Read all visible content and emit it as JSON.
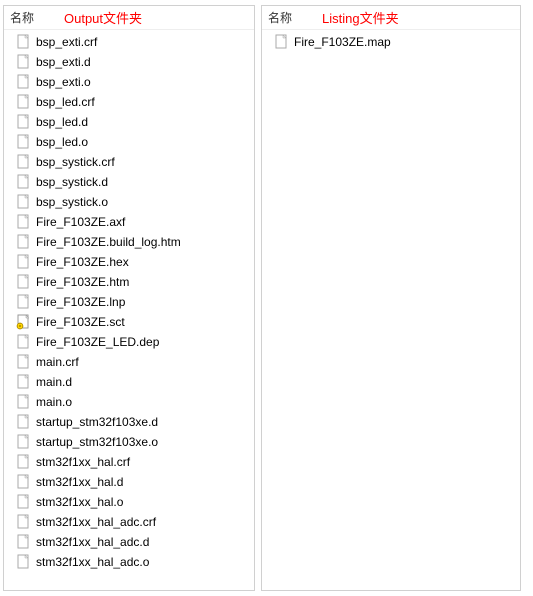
{
  "left": {
    "column_header": "名称",
    "folder_title": "Output文件夹",
    "files": [
      {
        "name": "bsp_exti.crf",
        "icon": "file"
      },
      {
        "name": "bsp_exti.d",
        "icon": "file"
      },
      {
        "name": "bsp_exti.o",
        "icon": "file"
      },
      {
        "name": "bsp_led.crf",
        "icon": "file"
      },
      {
        "name": "bsp_led.d",
        "icon": "file"
      },
      {
        "name": "bsp_led.o",
        "icon": "file"
      },
      {
        "name": "bsp_systick.crf",
        "icon": "file"
      },
      {
        "name": "bsp_systick.d",
        "icon": "file"
      },
      {
        "name": "bsp_systick.o",
        "icon": "file"
      },
      {
        "name": "Fire_F103ZE.axf",
        "icon": "file"
      },
      {
        "name": "Fire_F103ZE.build_log.htm",
        "icon": "file"
      },
      {
        "name": "Fire_F103ZE.hex",
        "icon": "file"
      },
      {
        "name": "Fire_F103ZE.htm",
        "icon": "file"
      },
      {
        "name": "Fire_F103ZE.lnp",
        "icon": "file"
      },
      {
        "name": "Fire_F103ZE.sct",
        "icon": "sct"
      },
      {
        "name": "Fire_F103ZE_LED.dep",
        "icon": "file"
      },
      {
        "name": "main.crf",
        "icon": "file"
      },
      {
        "name": "main.d",
        "icon": "file"
      },
      {
        "name": "main.o",
        "icon": "file"
      },
      {
        "name": "startup_stm32f103xe.d",
        "icon": "file"
      },
      {
        "name": "startup_stm32f103xe.o",
        "icon": "file"
      },
      {
        "name": "stm32f1xx_hal.crf",
        "icon": "file"
      },
      {
        "name": "stm32f1xx_hal.d",
        "icon": "file"
      },
      {
        "name": "stm32f1xx_hal.o",
        "icon": "file"
      },
      {
        "name": "stm32f1xx_hal_adc.crf",
        "icon": "file"
      },
      {
        "name": "stm32f1xx_hal_adc.d",
        "icon": "file"
      },
      {
        "name": "stm32f1xx_hal_adc.o",
        "icon": "file"
      }
    ]
  },
  "right": {
    "column_header": "名称",
    "folder_title": "Listing文件夹",
    "files": [
      {
        "name": "Fire_F103ZE.map",
        "icon": "file"
      }
    ]
  }
}
